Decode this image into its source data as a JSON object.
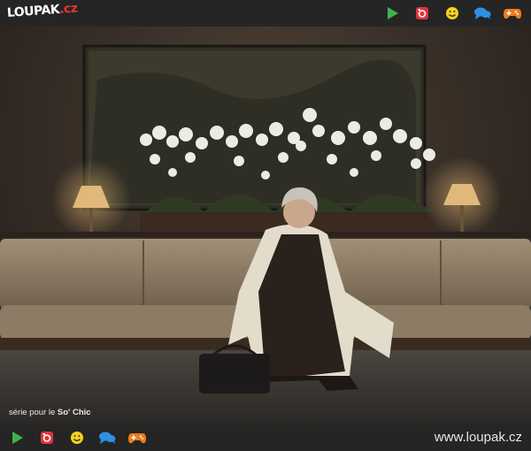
{
  "header": {
    "logo_main": "LOUPAK",
    "logo_tld": ".cz",
    "icons": [
      "play-icon",
      "instagram-icon",
      "smiley-icon",
      "chat-icon",
      "gamepad-icon"
    ]
  },
  "photo": {
    "caption_prefix": "série pour le",
    "caption_brand": "So' Chic"
  },
  "footer": {
    "icons": [
      "play-icon",
      "instagram-icon",
      "smiley-icon",
      "chat-icon",
      "gamepad-icon"
    ],
    "url": "www.loupak.cz"
  },
  "colors": {
    "bar_background": "#252525",
    "play": "#3cb44b",
    "instagram": "#e2333b",
    "smiley": "#f5d21b",
    "chat": "#2f8fe0",
    "gamepad": "#f07a1c",
    "logo_tld": "#e23a2b"
  }
}
